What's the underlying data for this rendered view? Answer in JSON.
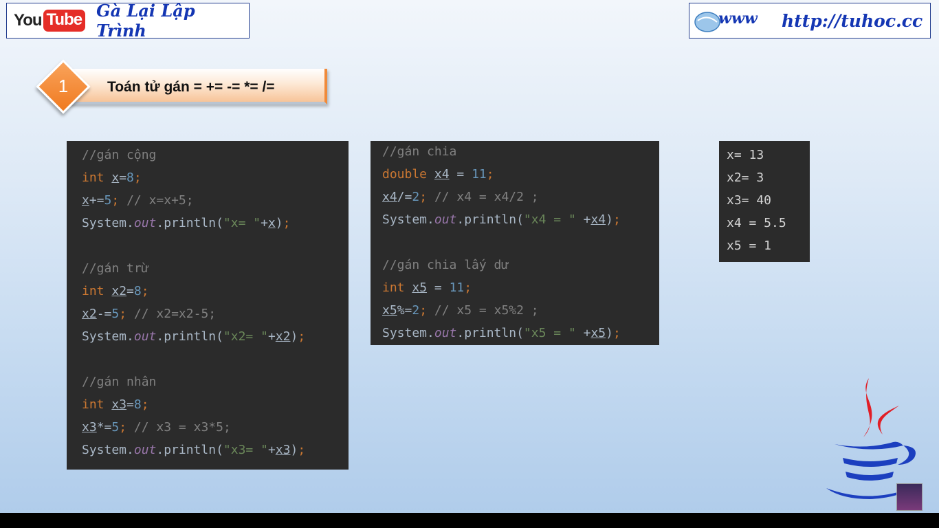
{
  "header": {
    "youtube_you": "You",
    "youtube_tube": "Tube",
    "channel_name": "Gà Lại Lập Trình",
    "site_url": "http://tuhoc.cc",
    "brand_color": "#1436b3"
  },
  "section": {
    "number": "1",
    "title": "Toán tử gán = += -= *= /="
  },
  "code_panel_1": {
    "c1": "//gán cộng",
    "c2": "//gán trừ",
    "c3": "//gán nhân",
    "v_x": "x",
    "v_x2": "x2",
    "v_x3": "x3",
    "kw_int": "int",
    "n8": "8",
    "n5": "5",
    "str_x": "\"x= \"",
    "str_x2": "\"x2= \"",
    "str_x3": "\"x3= \"",
    "cm_x": "// x=x+5;",
    "cm_x2": "// x2=x2-5;",
    "cm_x3": "// x3 = x3*5;"
  },
  "code_panel_2": {
    "c1": "//gán chia",
    "c2": "//gán chia lấy dư",
    "kw_double": "double",
    "kw_int": "int",
    "v_x4": "x4",
    "v_x5": "x5",
    "n11": "11",
    "n2": "2",
    "str_x4": "\"x4 = \"",
    "str_x5": "\"x5 = \"",
    "cm_x4": "// x4 = x4/2 ;",
    "cm_x5": "// x5 = x5%2 ;"
  },
  "output": {
    "lines": [
      "x= 13",
      "x2= 3",
      "x3= 40",
      "x4 = 5.5",
      "x5 = 1"
    ]
  }
}
